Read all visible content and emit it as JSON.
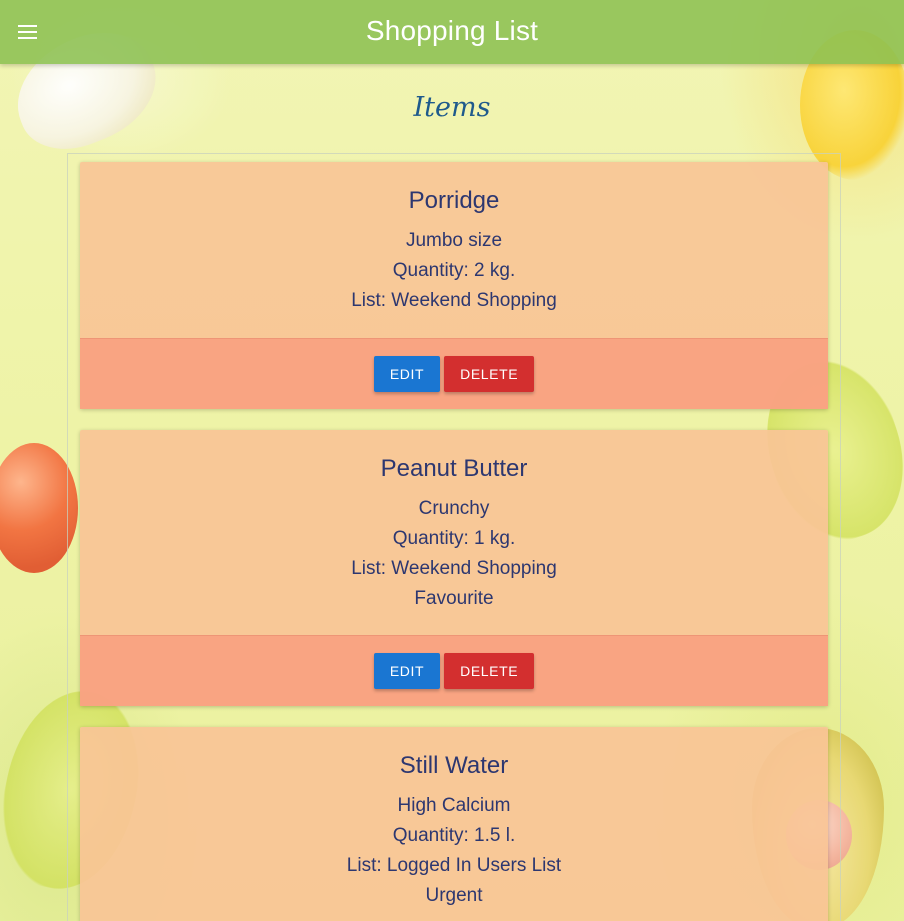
{
  "app": {
    "title": "Shopping List",
    "menu_icon": "hamburger-menu-icon"
  },
  "page": {
    "heading": "Items"
  },
  "colors": {
    "appbar": "#8cc052",
    "card_body": "#f8c496",
    "card_actions": "#f8a080",
    "edit_button": "#1a76d2",
    "delete_button": "#d32f2f",
    "heading": "#1f5a8c"
  },
  "items": [
    {
      "name": "Porridge",
      "description": "Jumbo size",
      "quantity": "Quantity: 2 kg.",
      "list": "List: Weekend Shopping",
      "edit_label": "EDIT",
      "delete_label": "DELETE"
    },
    {
      "name": "Peanut Butter",
      "description": "Crunchy",
      "quantity": "Quantity: 1 kg.",
      "list": "List: Weekend Shopping",
      "tag": "Favourite",
      "edit_label": "EDIT",
      "delete_label": "DELETE"
    },
    {
      "name": "Still Water",
      "description": "High Calcium",
      "quantity": "Quantity: 1.5 l.",
      "list": "List: Logged In Users List",
      "tag": "Urgent"
    }
  ]
}
